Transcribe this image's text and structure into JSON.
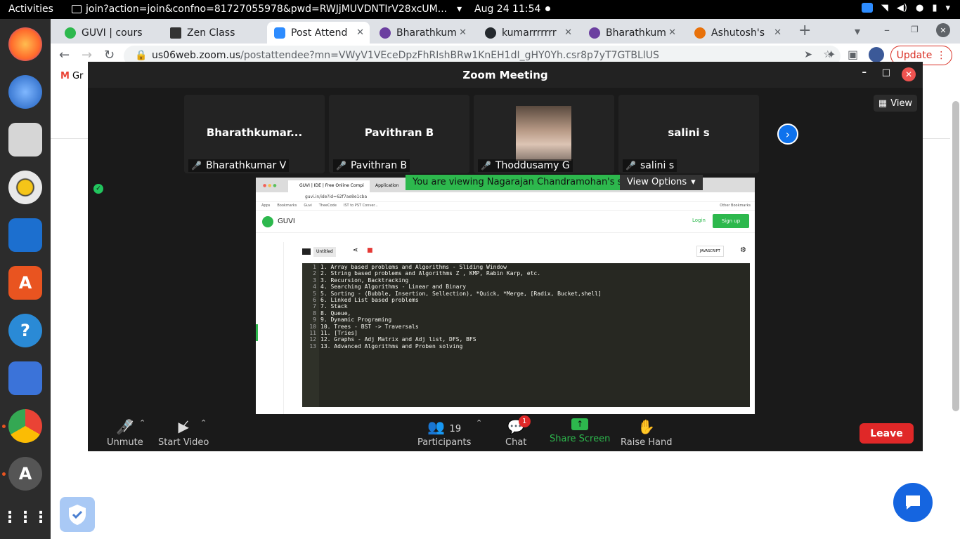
{
  "system_bar": {
    "activities": "Activities",
    "window_title": "join?action=join&confno=81727055978&pwd=RWJjMUVDNTIrV28xcUM...",
    "clock": "Aug 24  11:54"
  },
  "browser": {
    "tabs": [
      {
        "label": "GUVI | cours",
        "color": "#2db84d"
      },
      {
        "label": "Zen Class",
        "color": "#333333"
      },
      {
        "label": "Post Attend",
        "color": "#2d8cff"
      },
      {
        "label": "Bharathkum",
        "color": "#6b3fa0"
      },
      {
        "label": "kumarrrrrrr",
        "color": "#24292e"
      },
      {
        "label": "Bharathkum",
        "color": "#6b3fa0"
      },
      {
        "label": "Ashutosh's",
        "color": "#e8710a"
      }
    ],
    "url_host": "us06web.zoom.us",
    "url_path": "/postattendee?mn=VWyV1VEceDpzFhRIshBRw1KnEH1dI_gHY0Yh.csr8p7yT7GTBLlUS",
    "update_label": "Update",
    "bookmark_gmail": "Gr"
  },
  "zoom": {
    "window_title": "Zoom Meeting",
    "view_label": "View",
    "participants_tiles": [
      {
        "big": "Bharathkumar...",
        "name": "Bharathkumar V",
        "has_video": false
      },
      {
        "big": "Pavithran B",
        "name": "Pavithran B",
        "has_video": false
      },
      {
        "big": "",
        "name": "Thoddusamy G",
        "has_video": true
      },
      {
        "big": "salini s",
        "name": "salini s",
        "has_video": false
      }
    ],
    "viewing_banner": "You are viewing Nagarajan Chandramohan's screen",
    "view_options": "View Options",
    "bottom": {
      "unmute": "Unmute",
      "start_video": "Start Video",
      "participants_label": "Participants",
      "participants_count": "19",
      "chat": "Chat",
      "chat_badge": "1",
      "share_screen": "Share Screen",
      "raise_hand": "Raise Hand",
      "leave": "Leave"
    }
  },
  "shared_screen": {
    "tab_title": "GUVI | IDE | Free Online Compi",
    "tab2": "Application",
    "url": "guvi.in/ide?id=62f7ae8e1cba",
    "bookmarks": [
      "Apps",
      "Bookmarks",
      "Guvi",
      "TheeCode",
      "IST to PST Conver...",
      "Other Bookmarks"
    ],
    "brand": "GUVI",
    "login": "Login",
    "signup": "Sign up",
    "file_name": "Untitled",
    "language": "JAVASCRIPT",
    "code_lines": [
      {
        "n": "1",
        "text": "1. Array based problems and Algorithms - Sliding Window"
      },
      {
        "n": "2",
        "text": "2. String based problems and Algorithms  Z , KMP, Rabin Karp, etc."
      },
      {
        "n": "3",
        "text": "3. Recursion, Backtracking"
      },
      {
        "n": "4",
        "text": "4. Searching Algorithms - Linear and Binary"
      },
      {
        "n": "5",
        "text": "5. Sorting - (Bubble, Insertion, Sellection), *Quick, *Merge, [Radix, Bucket,shell]"
      },
      {
        "n": "6",
        "text": "6. Linked List based problems"
      },
      {
        "n": "7",
        "text": "7. Stack"
      },
      {
        "n": "8",
        "text": "8. Queue,"
      },
      {
        "n": "9",
        "text": "9. Dynamic Programing"
      },
      {
        "n": "10",
        "text": "10. Trees - BST -> Traversals"
      },
      {
        "n": "11",
        "text": "11. [Tries]"
      },
      {
        "n": "12",
        "text": "12. Graphs - Adj Matrix and Adj list, DFS, BFS"
      },
      {
        "n": "13",
        "text": "13. Advanced Algorithms and Proben solving"
      }
    ]
  }
}
